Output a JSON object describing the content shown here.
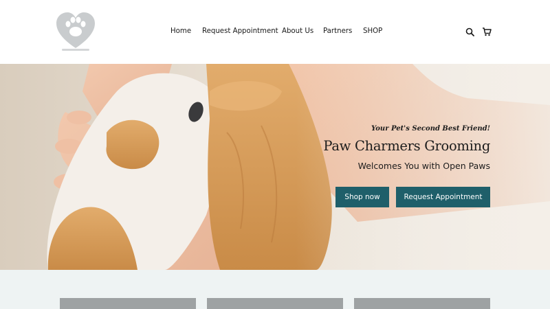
{
  "nav": {
    "items": [
      {
        "label": "Home"
      },
      {
        "label": "Request Appointment"
      },
      {
        "label": "About Us"
      },
      {
        "label": "Partners"
      },
      {
        "label": "SHOP"
      }
    ]
  },
  "header_icons": [
    "search-icon",
    "cart-icon"
  ],
  "hero": {
    "tagline": "Your Pet's Second Best Friend!",
    "title": "Paw Charmers Grooming",
    "subtitle": "Welcomes You with Open Paws",
    "buttons": {
      "shop": "Shop now",
      "request": "Request Appointment"
    }
  },
  "colors": {
    "accent": "#1f5f6a",
    "lower_bg": "#eef3f3",
    "card": "#9ea2a3"
  }
}
